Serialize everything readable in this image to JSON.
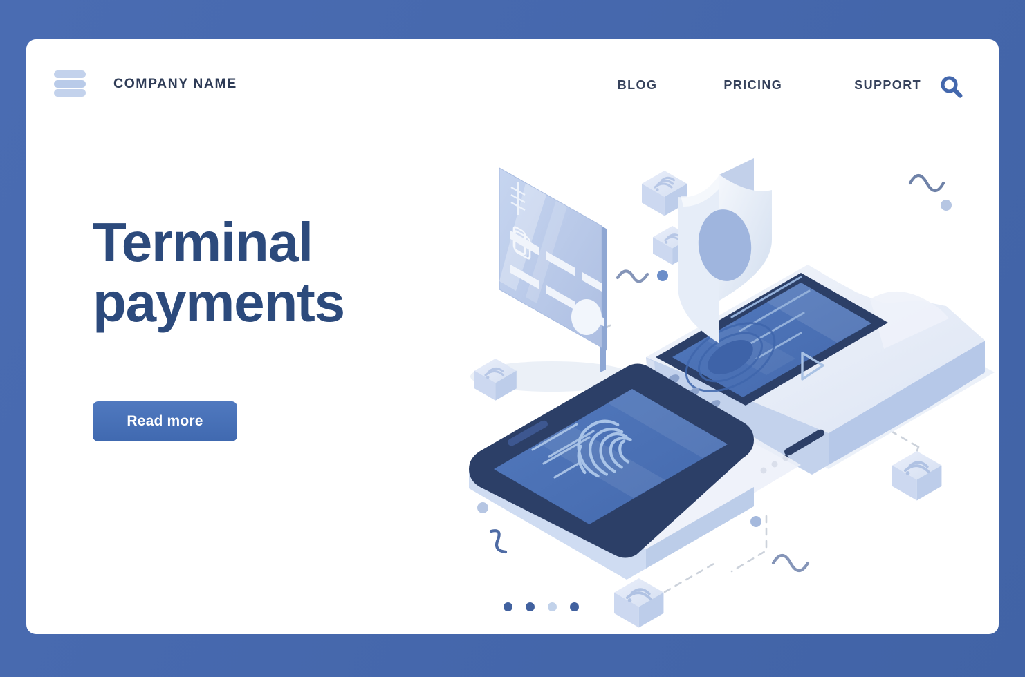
{
  "colors": {
    "page_background": "#4668ad",
    "card_background": "#ffffff",
    "heading": "#2c4a7c",
    "nav_text": "#36425c",
    "button_gradient_top": "#5079bf",
    "button_gradient_bottom": "#4069b0",
    "accent_light_blue": "#c3d2ec",
    "search_icon": "#4468ad",
    "dot_active": "#41619f",
    "dot_inactive": "#c2d2ea",
    "dashed_line": "#ccd2db",
    "device_dark": "#2c3f67",
    "device_screen": "#4d74b8",
    "device_body_light": "#e8edf7",
    "card_face": "#b8c9e8"
  },
  "header": {
    "menu_icon": "hamburger-icon",
    "brand": "COMPANY NAME",
    "nav": [
      {
        "label": "BLOG",
        "name": "nav-link-blog"
      },
      {
        "label": "PRICING",
        "name": "nav-link-pricing"
      },
      {
        "label": "SUPPORT",
        "name": "nav-link-support"
      }
    ],
    "search_icon": "search-icon"
  },
  "hero": {
    "title_line_1": "Terminal",
    "title_line_2": "payments",
    "cta_label": "Read more"
  },
  "illustration": {
    "name": "isometric-payment-terminal-illustration",
    "elements": [
      "credit-card",
      "payment-terminal",
      "smartphone-fingerprint",
      "security-shield",
      "nfc-contactless-cubes",
      "dashed-connection-lines",
      "decorative-squiggles",
      "decorative-dots",
      "play-triangle-icon",
      "fingerprint-icon"
    ],
    "nfc_cube_count": 5,
    "squiggle_count": 4,
    "dot_count": 4
  },
  "pagination": {
    "total": 4,
    "active_indexes": [
      0,
      1,
      3
    ],
    "inactive_indexes": [
      2
    ]
  }
}
